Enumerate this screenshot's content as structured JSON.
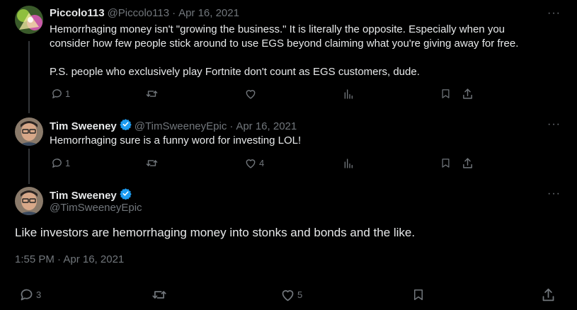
{
  "tweets": [
    {
      "name": "Piccolo113",
      "handle": "@Piccolo113",
      "sep": "·",
      "date": "Apr 16, 2021",
      "line1": "Hemorrhaging money isn't \"growing the business.\" It is literally the opposite. Especially when you",
      "line2": "consider how few people stick around to use EGS beyond claiming what you're giving away for free.",
      "line3": "P.S. people who exclusively play Fortnite don't count as EGS customers, dude.",
      "replies": "1",
      "retweets": "",
      "likes": ""
    },
    {
      "name": "Tim Sweeney",
      "handle": "@TimSweeneyEpic",
      "sep": "·",
      "date": "Apr 16, 2021",
      "line1": "Hemorrhaging sure is a funny word for investing LOL!",
      "replies": "1",
      "retweets": "",
      "likes": "4"
    }
  ],
  "main": {
    "name": "Tim Sweeney",
    "handle": "@TimSweeneyEpic",
    "text": "Like investors are hemorrhaging money into stonks and bonds and the like.",
    "timestamp": "1:55 PM · Apr 16, 2021",
    "replies": "3",
    "retweets": "",
    "likes": "5"
  },
  "icons": {
    "reply": "reply-icon",
    "retweet": "retweet-icon",
    "like": "like-icon",
    "views": "views-icon",
    "bookmark": "bookmark-icon",
    "share": "share-icon",
    "more": "more-icon",
    "verified": "verified-badge-icon"
  },
  "colors": {
    "background": "#000000",
    "text": "#e7e9ea",
    "muted": "#71767b",
    "verified": "#1d9bf0",
    "line": "#333639"
  }
}
